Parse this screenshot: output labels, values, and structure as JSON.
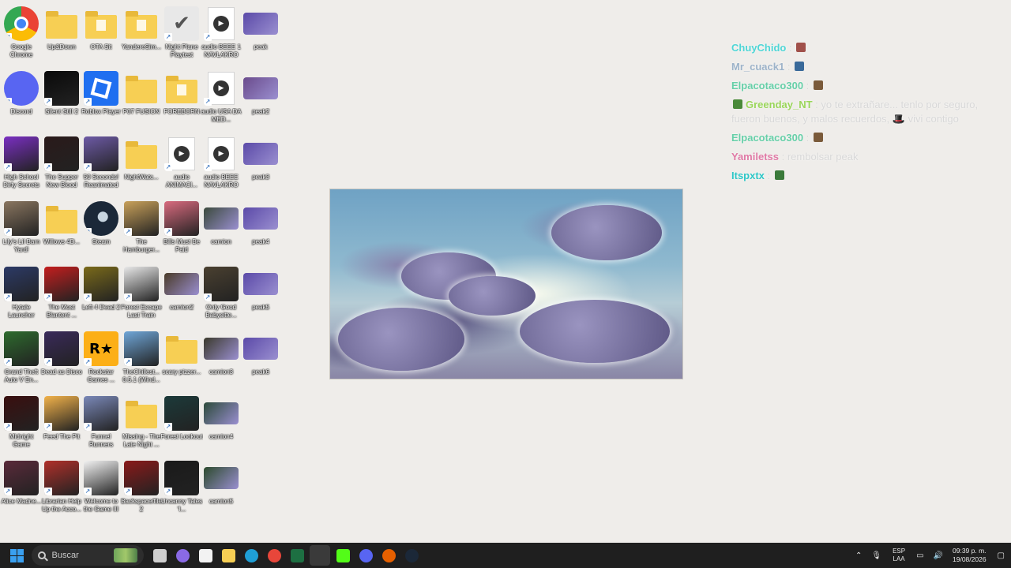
{
  "desktop": {
    "icons": [
      {
        "label": "Google Chrome",
        "icon": "chrome-icon",
        "kind": "app",
        "color": "#4285f4"
      },
      {
        "label": "Up&Down",
        "icon": "folder-icon",
        "kind": "folder"
      },
      {
        "label": "OTA Sit",
        "icon": "folder-icon",
        "kind": "folder-doc"
      },
      {
        "label": "YandereSim...",
        "icon": "folder-icon",
        "kind": "folder-doc"
      },
      {
        "label": "Night Plane Playtest",
        "icon": "checkmark-app-icon",
        "kind": "app",
        "color": "#e8e8e8"
      },
      {
        "label": "audio BEEE 1 NAVLAKRO",
        "icon": "media-file-icon",
        "kind": "media"
      },
      {
        "label": "peak",
        "icon": "image-file-icon",
        "kind": "image",
        "color": "#5b4aa8"
      },
      {
        "label": "Discord",
        "icon": "discord-icon",
        "kind": "app",
        "color": "#5865f2"
      },
      {
        "label": "Silent Still 2",
        "icon": "game-icon",
        "kind": "app",
        "color": "#0a0a0a"
      },
      {
        "label": "Roblox Player",
        "icon": "roblox-icon",
        "kind": "app",
        "color": "#1f6ff0"
      },
      {
        "label": "P07 FUSION",
        "icon": "folder-icon",
        "kind": "folder"
      },
      {
        "label": "FOREBORN",
        "icon": "folder-icon",
        "kind": "folder-doc"
      },
      {
        "label": "audio USA DA MED...",
        "icon": "media-file-icon",
        "kind": "media"
      },
      {
        "label": "peak2",
        "icon": "image-file-icon",
        "kind": "image",
        "color": "#6a4b8c"
      },
      {
        "label": "High School Dirty Secrets",
        "icon": "game-icon",
        "kind": "app",
        "color": "#7a2fc2"
      },
      {
        "label": "The Supper New Blood",
        "icon": "game-icon",
        "kind": "app",
        "color": "#2a1a1a"
      },
      {
        "label": "50 Seconds! Reanimated",
        "icon": "game-icon",
        "kind": "app",
        "color": "#6d5aa6"
      },
      {
        "label": "NightWatc...",
        "icon": "folder-icon",
        "kind": "folder"
      },
      {
        "label": "audio ANIMACI...",
        "icon": "media-file-icon",
        "kind": "media"
      },
      {
        "label": "audio BEEE NAVLAKRO",
        "icon": "media-file-icon",
        "kind": "media"
      },
      {
        "label": "peak3",
        "icon": "image-file-icon",
        "kind": "image",
        "color": "#5b4aa8"
      },
      {
        "label": "Lily's Lil Barn Yard!",
        "icon": "game-icon",
        "kind": "app",
        "color": "#8a7660"
      },
      {
        "label": "Willows 4D...",
        "icon": "folder-icon",
        "kind": "folder"
      },
      {
        "label": "Steam",
        "icon": "steam-icon",
        "kind": "app",
        "color": "#1b2838"
      },
      {
        "label": "The Hamburger...",
        "icon": "game-icon",
        "kind": "app",
        "color": "#c9a15a"
      },
      {
        "label": "Bills Must Be Paid",
        "icon": "game-icon",
        "kind": "app",
        "color": "#d96a7e"
      },
      {
        "label": "camion",
        "icon": "image-file-icon",
        "kind": "image",
        "color": "#3b4a3c"
      },
      {
        "label": "peak4",
        "icon": "image-file-icon",
        "kind": "image",
        "color": "#5b4aa8"
      },
      {
        "label": "Hytale Launcher",
        "icon": "hytale-icon",
        "kind": "app",
        "color": "#2c3a66"
      },
      {
        "label": "The Most Blantent ...",
        "icon": "game-icon",
        "kind": "app",
        "color": "#c41e1e"
      },
      {
        "label": "Left 4 Dead 2",
        "icon": "game-icon",
        "kind": "app",
        "color": "#7a6a1a"
      },
      {
        "label": "Forest Escape Last Train",
        "icon": "game-icon",
        "kind": "app",
        "color": "#e8e8e8"
      },
      {
        "label": "camion2",
        "icon": "image-file-icon",
        "kind": "image",
        "color": "#4a3b28"
      },
      {
        "label": "Only Good Babysitte...",
        "icon": "game-icon",
        "kind": "app",
        "color": "#4a4030"
      },
      {
        "label": "peak5",
        "icon": "image-file-icon",
        "kind": "image",
        "color": "#5b4aa8"
      },
      {
        "label": "Grand Theft Auto V En...",
        "icon": "gta-icon",
        "kind": "app",
        "color": "#2e6b2e"
      },
      {
        "label": "Dead as Disco",
        "icon": "game-icon",
        "kind": "app",
        "color": "#3a2a5a"
      },
      {
        "label": "Rockstar Games ...",
        "icon": "rockstar-icon",
        "kind": "app",
        "color": "#fcaf17"
      },
      {
        "label": "TheChillest... 0.5.1 (Wind...",
        "icon": "game-icon",
        "kind": "app",
        "color": "#6fa6d8"
      },
      {
        "label": "scary pizzer...",
        "icon": "folder-icon",
        "kind": "folder"
      },
      {
        "label": "camion3",
        "icon": "image-file-icon",
        "kind": "image",
        "color": "#3b3a2c"
      },
      {
        "label": "peak6",
        "icon": "image-file-icon",
        "kind": "image",
        "color": "#5b4aa8"
      },
      {
        "label": "Midnight Game",
        "icon": "game-icon",
        "kind": "app",
        "color": "#3a0f0f"
      },
      {
        "label": "Feed The Pit",
        "icon": "game-icon",
        "kind": "app",
        "color": "#f2b24a"
      },
      {
        "label": "Funnel Runners",
        "icon": "game-icon",
        "kind": "app",
        "color": "#7a88b8"
      },
      {
        "label": "Missing - The Late Night ...",
        "icon": "folder-icon",
        "kind": "folder"
      },
      {
        "label": "Forest Lookout",
        "icon": "game-icon",
        "kind": "app",
        "color": "#1c3a3a"
      },
      {
        "label": "camion4",
        "icon": "image-file-icon",
        "kind": "image",
        "color": "#2c4a3a"
      },
      {
        "label": "Alice Madne...",
        "icon": "game-icon",
        "kind": "app",
        "color": "#5a2a3a"
      },
      {
        "label": "Librarian Help Up the Acco...",
        "icon": "game-icon",
        "kind": "app",
        "color": "#b0302a"
      },
      {
        "label": "Welcome to the Game III",
        "icon": "game-icon",
        "kind": "app",
        "color": "#f2f2f2"
      },
      {
        "label": "Backspace/file 2",
        "icon": "game-icon",
        "kind": "app",
        "color": "#8a1a1a"
      },
      {
        "label": "Uncanny Tales ‘I...",
        "icon": "game-icon",
        "kind": "app",
        "color": "#1a1a1a"
      },
      {
        "label": "camion5",
        "icon": "image-file-icon",
        "kind": "image",
        "color": "#2c4a2c"
      }
    ]
  },
  "chat": {
    "messages": [
      {
        "user": "ChuyChido",
        "user_color": "#4fd6d6",
        "text": "",
        "emote_color": "#a0504a"
      },
      {
        "user": "Mr_cuack1",
        "user_color": "#9db3c9",
        "text": "",
        "emote_color": "#3a6a9a"
      },
      {
        "user": "Elpacotaco300",
        "user_color": "#66cfa8",
        "text": "",
        "emote_color": "#7a5a3a"
      },
      {
        "user": "Greenday_NT",
        "user_color": "#9ad65a",
        "text": "yo te extrañare... tenlo por seguro, fueron buenos, y malos recuerdos, 🎩 vivi contigo",
        "emote_color": "#4a8a3a",
        "prefix_badge": true
      },
      {
        "user": "Elpacotaco300",
        "user_color": "#66cfa8",
        "text": "",
        "emote_color": "#7a5a3a"
      },
      {
        "user": "Yamiletss",
        "user_color": "#e07aa6",
        "text": "rembolsar peak",
        "emote_color": ""
      },
      {
        "user": "Itspxtx",
        "user_color": "#2ec7c7",
        "text": "",
        "emote_color": "#3a7a3a"
      }
    ]
  },
  "taskbar": {
    "search_placeholder": "Buscar",
    "apps": [
      {
        "name": "task-view",
        "color": "#cfcfcf"
      },
      {
        "name": "copilot",
        "color": "#8a6ae6"
      },
      {
        "name": "microsoft-store",
        "color": "#f2f2f2"
      },
      {
        "name": "file-explorer",
        "color": "#f7cf54"
      },
      {
        "name": "edge",
        "color": "#1f9fd6"
      },
      {
        "name": "chrome",
        "color": "#e8463a"
      },
      {
        "name": "excel",
        "color": "#1d6f42"
      },
      {
        "name": "obs",
        "color": "#3a3a3a"
      },
      {
        "name": "kick",
        "color": "#53fc18"
      },
      {
        "name": "discord",
        "color": "#5865f2"
      },
      {
        "name": "firefox",
        "color": "#e66000"
      },
      {
        "name": "steam",
        "color": "#1b2838"
      }
    ],
    "language": "ESP",
    "language_region": "LAA",
    "time": "09:39 p. m.",
    "date": "19/08/2026"
  }
}
